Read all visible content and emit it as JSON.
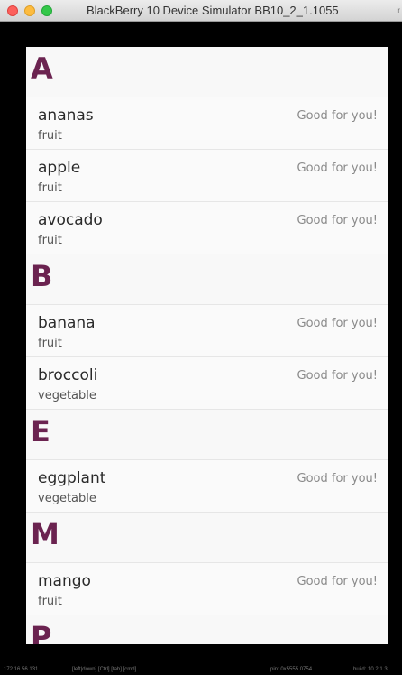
{
  "window": {
    "title": "BlackBerry 10 Device Simulator BB10_2_1.1055",
    "title_tail": "ir"
  },
  "list": [
    {
      "header": "A",
      "items": [
        {
          "title": "ananas",
          "description": "fruit",
          "status": "Good for you!"
        },
        {
          "title": "apple",
          "description": "fruit",
          "status": "Good for you!"
        },
        {
          "title": "avocado",
          "description": "fruit",
          "status": "Good for you!"
        }
      ]
    },
    {
      "header": "B",
      "items": [
        {
          "title": "banana",
          "description": "fruit",
          "status": "Good for you!"
        },
        {
          "title": "broccoli",
          "description": "vegetable",
          "status": "Good for you!"
        }
      ]
    },
    {
      "header": "E",
      "items": [
        {
          "title": "eggplant",
          "description": "vegetable",
          "status": "Good for you!"
        }
      ]
    },
    {
      "header": "M",
      "items": [
        {
          "title": "mango",
          "description": "fruit",
          "status": "Good for you!"
        }
      ]
    },
    {
      "header": "P",
      "items": []
    }
  ],
  "statusbar": {
    "ip": "172.16.56.131",
    "keys": "[left|down] [Ctrl] [tab] [cmd]",
    "pin": "pin: 0x5555 0754",
    "build": "build: 10.2.1.3"
  }
}
